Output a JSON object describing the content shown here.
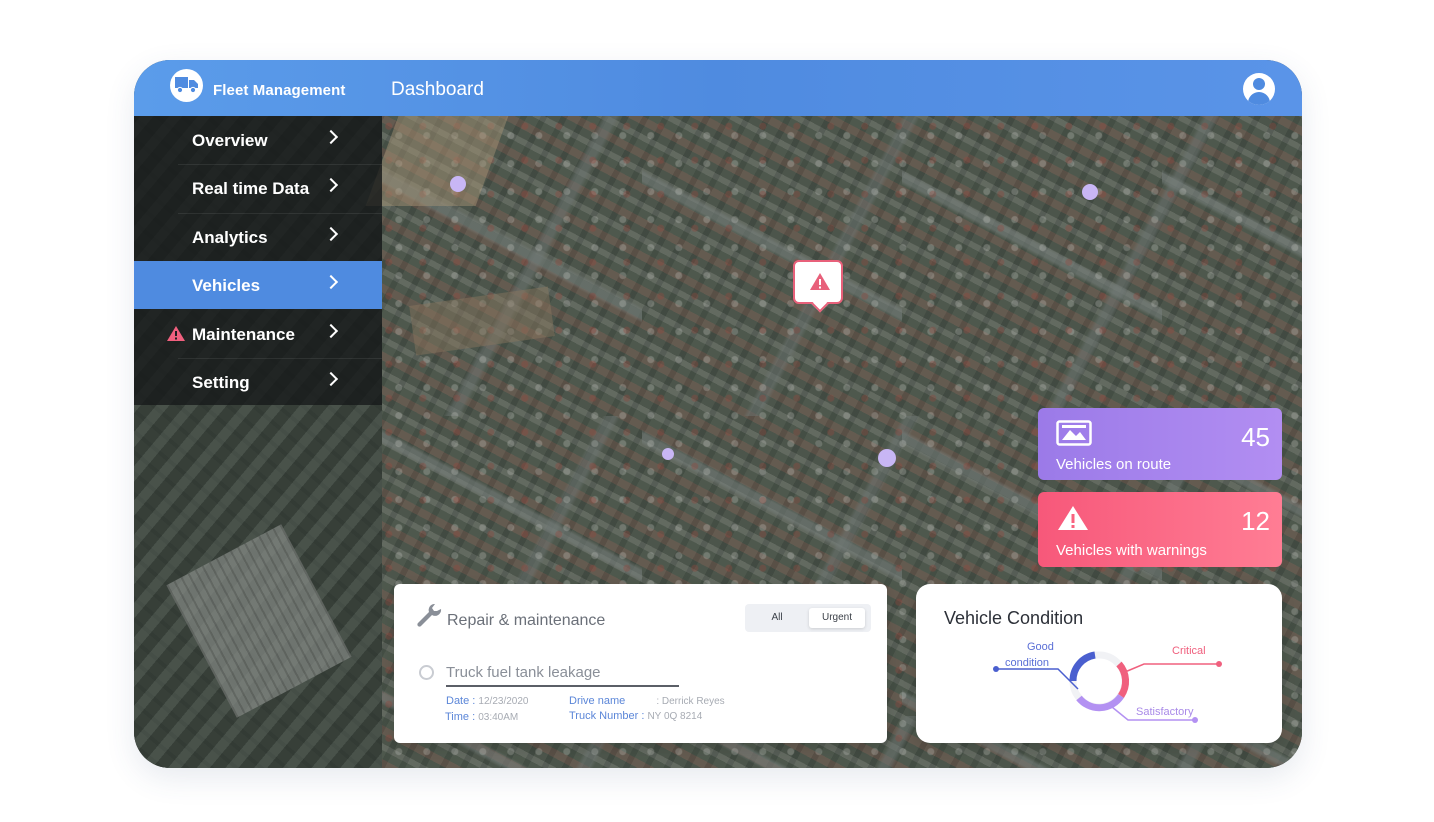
{
  "header": {
    "app_name": "Fleet Management",
    "page_title": "Dashboard",
    "logo_icon": "truck-icon",
    "avatar_icon": "user-icon",
    "bg_color": "#4f8be0"
  },
  "sidebar": {
    "items": [
      {
        "label": "Overview",
        "active": false
      },
      {
        "label": "Real time Data",
        "active": false
      },
      {
        "label": "Analytics",
        "active": false
      },
      {
        "label": "Vehicles",
        "active": true
      },
      {
        "label": "Maintenance",
        "active": false,
        "icon": "warning-icon"
      },
      {
        "label": "Setting",
        "active": false
      }
    ],
    "active_color": "#4f8be0"
  },
  "map": {
    "alert_icon": "warning-icon",
    "alert_color": "#e8607a"
  },
  "stats": {
    "on_route": {
      "value": "45",
      "label": "Vehicles on route",
      "icon": "image-icon",
      "color": "#a584ee"
    },
    "warnings": {
      "value": "12",
      "label": "Vehicles with warnings",
      "icon": "warning-icon",
      "color": "#f9637f"
    }
  },
  "repair": {
    "title": "Repair & maintenance",
    "filter_options": [
      "All",
      "Urgent"
    ],
    "selected_filter": "Urgent",
    "task": {
      "title": "Truck fuel tank leakage",
      "date_label": "Date :",
      "date_value": "12/23/2020",
      "time_label": "Time :",
      "time_value": "03:40AM",
      "driver_label": "Drive name",
      "driver_value": ": Derrick Reyes",
      "truck_label": "Truck Number :",
      "truck_value": "NY 0Q 8214"
    }
  },
  "condition": {
    "title": "Vehicle Condition",
    "legend": {
      "good_line1": "Good",
      "good_line2": "condition",
      "critical": "Critical",
      "satisfactory": "Satisfactory"
    },
    "colors": {
      "good": "#4a5fcf",
      "critical": "#f0607e",
      "satisfactory": "#b391f2"
    }
  }
}
